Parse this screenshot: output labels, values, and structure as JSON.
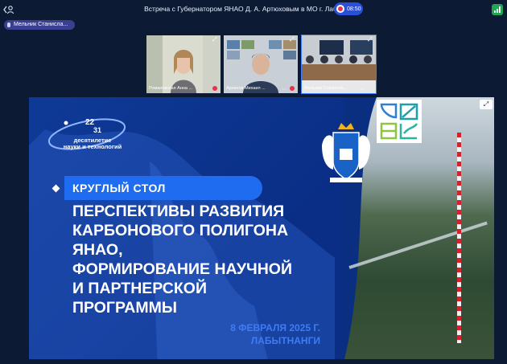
{
  "header": {
    "meeting_title": "Встреча с Губернатором ЯНАО Д. А. Артюховым в МО г. Лабытнанги",
    "record_time": "08:50"
  },
  "user_chip": {
    "label": "Мельник Станисла..."
  },
  "participants": [
    {
      "name": "Романовская Анна ...",
      "mic_muted": true
    },
    {
      "name": "Арханов Михаил ...",
      "mic_muted": true
    },
    {
      "name": "Мельник Станисла...",
      "mic_muted": false,
      "active": true
    }
  ],
  "slide": {
    "decade_numbers": [
      "22",
      "31"
    ],
    "decade_title": "десятилетие",
    "decade_subtitle": "науки и технологий",
    "section_label": "КРУГЛЫЙ СТОЛ",
    "headline_lines": [
      "ПЕРСПЕКТИВЫ РАЗВИТИЯ",
      "КАРБОНОВОГО ПОЛИГОНА",
      "ЯНАО,",
      "ФОРМИРОВАНИЕ НАУЧНОЙ",
      "И ПАРТНЕРСКОЙ",
      "ПРОГРАММЫ"
    ],
    "date": "8 ФЕВРАЛЯ 2025 Г.",
    "city": "ЛАБЫТНАНГИ"
  },
  "icons": {
    "back": "back-user-icon",
    "record": "record-icon",
    "signal": "signal-icon",
    "expand": "expand-icon",
    "fullscreen": "fullscreen-icon",
    "mic": "microphone-icon"
  },
  "colors": {
    "accent": "#2a4fd8",
    "slide_blue": "#0e3a96",
    "highlight_blue": "#1f6cf0",
    "mute_red": "#e8334a"
  }
}
